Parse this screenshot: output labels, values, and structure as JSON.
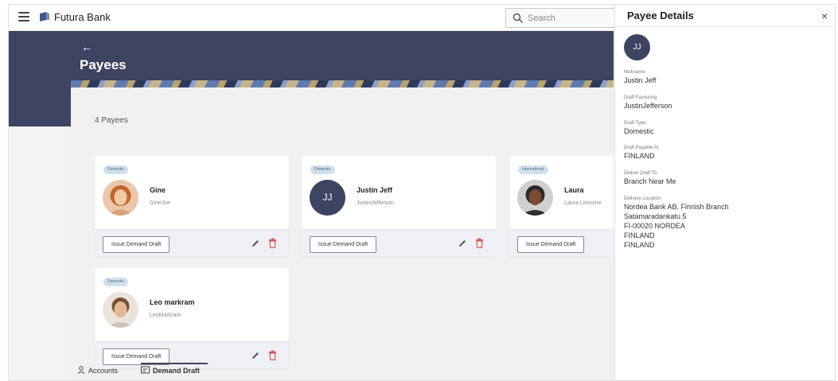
{
  "app": {
    "brand": "Futura Bank",
    "search_placeholder": "Search"
  },
  "page": {
    "back": "←",
    "title": "Payees",
    "payee_count": "4 Payees"
  },
  "payees": [
    {
      "type": "Domestic",
      "name": "Gine",
      "sub": "GineJoe",
      "action": "Issue Demand Draft"
    },
    {
      "type": "Domestic",
      "name": "Justin Jeff",
      "sub": "JustinJefferson",
      "initials": "JJ",
      "action": "Issue Demand Draft"
    },
    {
      "type": "International",
      "name": "Laura",
      "sub": "Laura Lemoine",
      "action": "Issue Demand Draft"
    },
    {
      "type": "Domestic",
      "name": "Leo markram",
      "sub": "LeoMarkram",
      "action": "Issue Demand Draft"
    }
  ],
  "bottom_tabs": {
    "accounts": "Accounts",
    "demand_draft": "Demand Draft"
  },
  "panel": {
    "title": "Payee Details",
    "close": "×",
    "initials": "JJ",
    "fields": [
      {
        "label": "Nickname",
        "value": "Justin Jeff"
      },
      {
        "label": "Draft Favouring",
        "value": "JustinJefferson"
      },
      {
        "label": "Draft Type",
        "value": "Domestic"
      },
      {
        "label": "Draft Payable At",
        "value": "FINLAND"
      },
      {
        "label": "Deliver Draft To",
        "value": "Branch Near Me"
      },
      {
        "label": "Delivery Location",
        "lines": [
          "Nordea Bank AB, Finnish Branch",
          "Satamaradankatu 5",
          "FI-00020 NORDEA",
          "FINLAND",
          "FINLAND"
        ]
      }
    ]
  },
  "colors": {
    "header": "#3d4461",
    "badge_bg": "#cfe0ec",
    "delete": "#d9534f"
  }
}
